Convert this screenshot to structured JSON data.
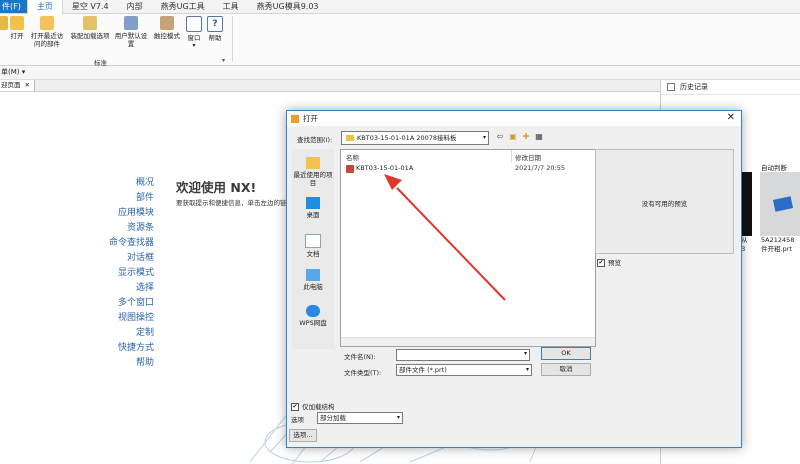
{
  "menubar": {
    "file": "件(F)",
    "items": [
      "主页",
      "星空 V7.4",
      "内部",
      "燕秀UG工具",
      "工具",
      "燕秀UG模具9.03"
    ]
  },
  "ribbon": {
    "buttons": [
      "打开",
      "打开最近访\n问的部件",
      "装配加载选项",
      "用户默认设置",
      "触控模式",
      "窗口",
      "帮助"
    ],
    "group_label": "标准"
  },
  "toolbar": {
    "menu": "单(M) ▾"
  },
  "tab": {
    "label": "迎页面",
    "close": "✕"
  },
  "welcome": {
    "title": "欢迎使用 NX!",
    "subtitle": "要获取提示和便捷信息，单击左边的链",
    "links": [
      "概况",
      "部件",
      "应用模块",
      "资源条",
      "命令查找器",
      "对话框",
      "显示模式",
      "选择",
      "多个窗口",
      "视图操控",
      "定制",
      "快捷方式",
      "帮助"
    ]
  },
  "history": {
    "title": "历史记录",
    "label": "自动判断",
    "item_name": "5A212458",
    "item_name2": "件开粗.prt",
    "partial_name": ", 从\n03"
  },
  "dialog": {
    "title": "打开",
    "close": "✕",
    "look_in_label": "查找范围(I):",
    "look_in_value": "KBT03-15-01-01A 20078接料板",
    "places": [
      "最近使用的项目",
      "桌面",
      "文档",
      "此电脑",
      "WPS网盘"
    ],
    "columns": {
      "name": "名称",
      "date": "修改日期"
    },
    "files": [
      {
        "name": "KBT03-15-01-01A",
        "date": "2021/7/7 20:55"
      }
    ],
    "preview_text": "没有可用的预览",
    "preview_checkbox": "预览",
    "filename_label": "文件名(N):",
    "filename_value": "",
    "filetype_label": "文件类型(T):",
    "filetype_value": "部件文件 (*.prt)",
    "ok": "OK",
    "cancel": "取消",
    "load_structure": "仅加载结构",
    "options_label": "选项",
    "options_value": "部分加载",
    "options_button": "选项..."
  },
  "colors": {
    "accent": "#1c75c6",
    "link": "#2b64a8",
    "arrow": "#e2362c"
  }
}
